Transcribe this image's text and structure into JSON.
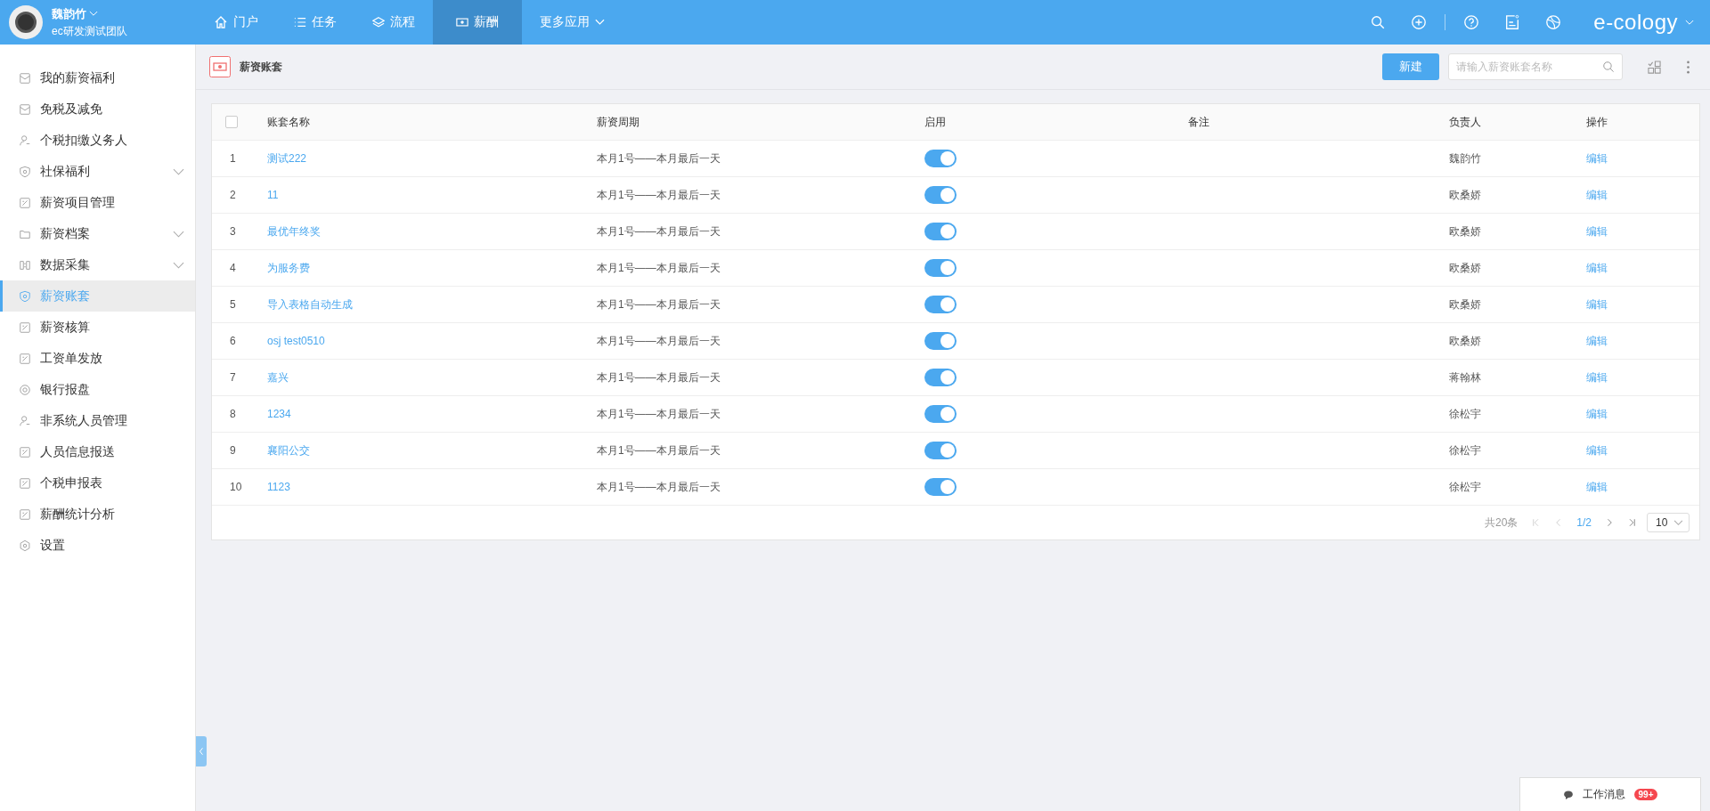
{
  "top_bar": {
    "user_name": "魏韵竹",
    "team": "ec研发测试团队",
    "brand": "e-cology",
    "nav": [
      {
        "label": "门户",
        "kind": "home",
        "selected": false
      },
      {
        "label": "任务",
        "kind": "list",
        "selected": false
      },
      {
        "label": "流程",
        "kind": "layers",
        "selected": false
      },
      {
        "label": "薪酬",
        "kind": "money",
        "selected": true
      },
      {
        "label": "更多应用",
        "kind": "more",
        "selected": false
      }
    ]
  },
  "sidebar": {
    "items": [
      {
        "label": "我的薪资福利",
        "kind": "mail",
        "expandable": false,
        "selected": false
      },
      {
        "label": "免税及减免",
        "kind": "mail",
        "expandable": false,
        "selected": false
      },
      {
        "label": "个税扣缴义务人",
        "kind": "person",
        "expandable": false,
        "selected": false
      },
      {
        "label": "社保福利",
        "kind": "shield",
        "expandable": true,
        "selected": false
      },
      {
        "label": "薪资项目管理",
        "kind": "doc",
        "expandable": false,
        "selected": false
      },
      {
        "label": "薪资档案",
        "kind": "folder",
        "expandable": true,
        "selected": false
      },
      {
        "label": "数据采集",
        "kind": "grid",
        "expandable": true,
        "selected": false
      },
      {
        "label": "薪资账套",
        "kind": "shield",
        "expandable": false,
        "selected": true
      },
      {
        "label": "薪资核算",
        "kind": "doc",
        "expandable": false,
        "selected": false
      },
      {
        "label": "工资单发放",
        "kind": "doc",
        "expandable": false,
        "selected": false
      },
      {
        "label": "银行报盘",
        "kind": "at",
        "expandable": false,
        "selected": false
      },
      {
        "label": "非系统人员管理",
        "kind": "person",
        "expandable": false,
        "selected": false
      },
      {
        "label": "人员信息报送",
        "kind": "doc",
        "expandable": false,
        "selected": false
      },
      {
        "label": "个税申报表",
        "kind": "doc",
        "expandable": false,
        "selected": false
      },
      {
        "label": "薪酬统计分析",
        "kind": "doc",
        "expandable": false,
        "selected": false
      },
      {
        "label": "设置",
        "kind": "gear",
        "expandable": false,
        "selected": false
      }
    ]
  },
  "page_header": {
    "title": "薪资账套",
    "new_button": "新建",
    "search": {
      "placeholder": "请输入薪资账套名称"
    }
  },
  "table": {
    "select_all": {
      "checked": false
    },
    "columns": [
      "账套名称",
      "薪资周期",
      "启用",
      "备注",
      "负责人",
      "操作"
    ],
    "rows": [
      {
        "index": "1",
        "name": "测试222",
        "period": "本月1号——本月最后一天",
        "enabled": true,
        "owner": "魏韵竹",
        "action": "编辑"
      },
      {
        "index": "2",
        "name": "11",
        "period": "本月1号——本月最后一天",
        "enabled": true,
        "owner": "欧桑娇",
        "action": "编辑"
      },
      {
        "index": "3",
        "name": "最优年终奖",
        "period": "本月1号——本月最后一天",
        "enabled": true,
        "owner": "欧桑娇",
        "action": "编辑"
      },
      {
        "index": "4",
        "name": "为服务费",
        "period": "本月1号——本月最后一天",
        "enabled": true,
        "owner": "欧桑娇",
        "action": "编辑"
      },
      {
        "index": "5",
        "name": "导入表格自动生成",
        "period": "本月1号——本月最后一天",
        "enabled": true,
        "owner": "欧桑娇",
        "action": "编辑"
      },
      {
        "index": "6",
        "name": "osj test0510",
        "period": "本月1号——本月最后一天",
        "enabled": true,
        "owner": "欧桑娇",
        "action": "编辑"
      },
      {
        "index": "7",
        "name": "嘉兴",
        "period": "本月1号——本月最后一天",
        "enabled": true,
        "owner": "蒋翰林",
        "action": "编辑"
      },
      {
        "index": "8",
        "name": "1234",
        "period": "本月1号——本月最后一天",
        "enabled": true,
        "owner": "徐松宇",
        "action": "编辑"
      },
      {
        "index": "9",
        "name": "襄阳公交",
        "period": "本月1号——本月最后一天",
        "enabled": true,
        "owner": "徐松宇",
        "action": "编辑"
      },
      {
        "index": "10",
        "name": "1123",
        "period": "本月1号——本月最后一天",
        "enabled": true,
        "owner": "徐松宇",
        "action": "编辑"
      }
    ]
  },
  "pagination": {
    "total": "共20条",
    "page": "1/2",
    "page_size": "10",
    "controls": [
      {
        "kind": "first",
        "disabled": true
      },
      {
        "kind": "prev",
        "disabled": true
      },
      {
        "kind": "next",
        "disabled": false
      },
      {
        "kind": "last",
        "disabled": false
      }
    ]
  },
  "message_bar": {
    "label": "工作消息",
    "badge": "99+"
  }
}
